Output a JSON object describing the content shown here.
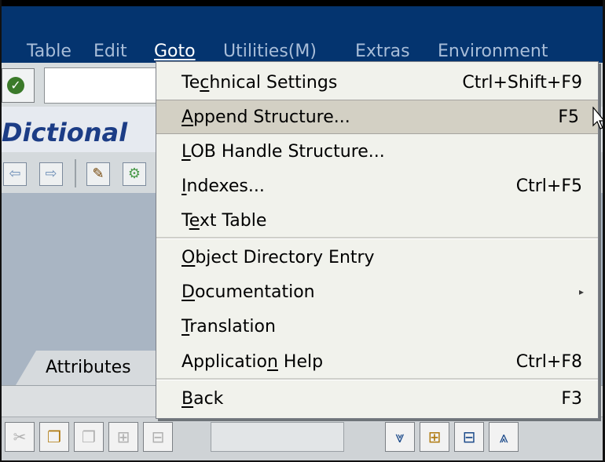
{
  "menubar": {
    "items": [
      {
        "label": "Table",
        "active": false
      },
      {
        "label": "Edit",
        "active": false
      },
      {
        "label": "Goto",
        "active": true
      },
      {
        "label": "Utilities(M)",
        "active": false
      },
      {
        "label": "Extras",
        "active": false
      },
      {
        "label": "Environment",
        "active": false
      }
    ]
  },
  "header": {
    "title": "Dictional"
  },
  "tabs": {
    "attributes": "Attributes"
  },
  "dropdown": {
    "items": [
      {
        "label": "Technical Settings",
        "mnemonic": "c",
        "shortcut": "Ctrl+Shift+F9"
      },
      {
        "label": "Append Structure...",
        "mnemonic": "A",
        "shortcut": "F5"
      },
      {
        "label": "LOB Handle Structure...",
        "mnemonic": "L",
        "shortcut": ""
      },
      {
        "label": "Indexes...",
        "mnemonic": "I",
        "shortcut": "Ctrl+F5"
      },
      {
        "label": "Text Table",
        "mnemonic": "e",
        "shortcut": ""
      },
      {
        "label": "Object Directory Entry",
        "mnemonic": "O",
        "shortcut": ""
      },
      {
        "label": "Documentation",
        "mnemonic": "D",
        "shortcut": ""
      },
      {
        "label": "Translation",
        "mnemonic": "T",
        "shortcut": ""
      },
      {
        "label": "Application Help",
        "mnemonic": "n",
        "shortcut": "Ctrl+F8"
      },
      {
        "label": "Back",
        "mnemonic": "B",
        "shortcut": "F3"
      }
    ],
    "hovered_index": 1,
    "submenu_item": "Documentation"
  },
  "colors": {
    "menubar_bg": "#04346f",
    "menu_bg": "#f1f2ec",
    "hover_bg": "#d3d0c4",
    "title_color": "#1c3d86"
  }
}
